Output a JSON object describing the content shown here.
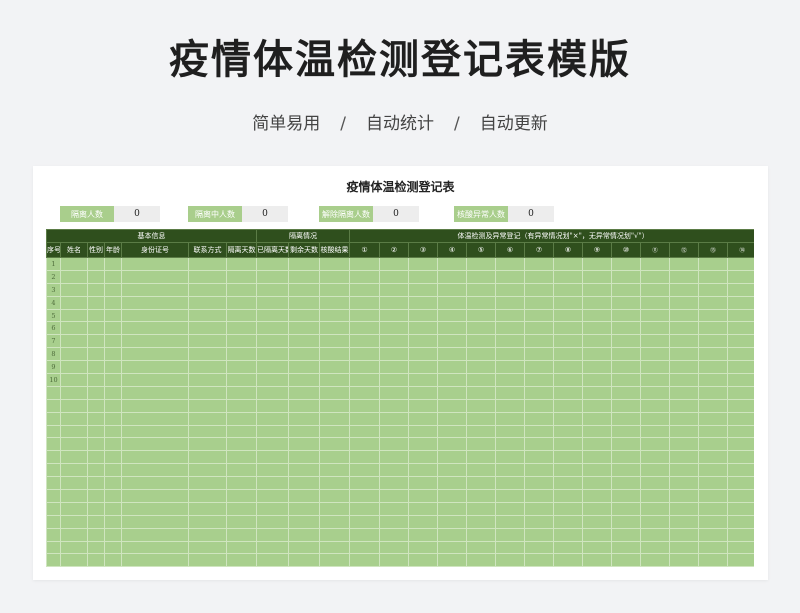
{
  "hero": {
    "title": "疫情体温检测登记表模版",
    "subtitle_items": [
      "简单易用",
      "自动统计",
      "自动更新"
    ],
    "separator": "/"
  },
  "sheet": {
    "title": "疫情体温检测登记表",
    "stats": [
      {
        "label": "隔离人数",
        "value": "0"
      },
      {
        "label": "隔离中人数",
        "value": "0"
      },
      {
        "label": "解除隔离人数",
        "value": "0"
      },
      {
        "label": "核酸异常人数",
        "value": "0"
      }
    ],
    "groups": [
      {
        "label": "基本信息"
      },
      {
        "label": "隔离情况"
      },
      {
        "label": "体温检测及异常登记（有异常情况划\"×\"，无异常情况划\"√\"）"
      }
    ],
    "columns": [
      "序号",
      "姓名",
      "性别",
      "年龄",
      "身份证号",
      "联系方式",
      "隔离天数",
      "已隔离天数",
      "剩余天数",
      "核酸结果",
      "①",
      "②",
      "③",
      "④",
      "⑤",
      "⑥",
      "⑦",
      "⑧",
      "⑨",
      "⑩",
      "⑪",
      "⑫",
      "⑬",
      "⑭"
    ],
    "row_numbers": [
      "1",
      "2",
      "3",
      "4",
      "5",
      "6",
      "7",
      "8",
      "9",
      "10"
    ],
    "empty_rows": 14,
    "colors": {
      "header_bg": "#2f4f1d",
      "grid_bg": "#a8cf8d",
      "stat_label_bg": "#a9ce8c"
    }
  }
}
